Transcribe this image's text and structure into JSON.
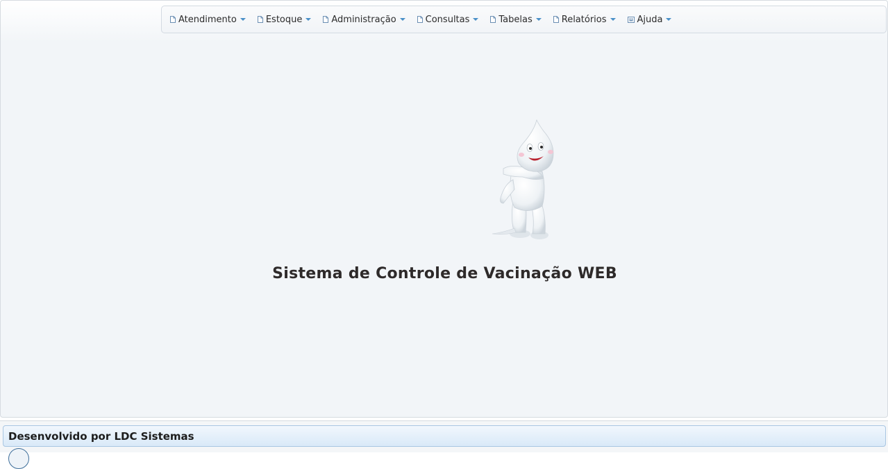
{
  "menu": {
    "items": [
      {
        "label": "Atendimento",
        "icon": "document-icon"
      },
      {
        "label": "Estoque",
        "icon": "document-icon"
      },
      {
        "label": "Administração",
        "icon": "document-icon"
      },
      {
        "label": "Consultas",
        "icon": "document-icon"
      },
      {
        "label": "Tabelas",
        "icon": "document-icon"
      },
      {
        "label": "Relatórios",
        "icon": "document-icon"
      },
      {
        "label": "Ajuda",
        "icon": "help-grid-icon"
      }
    ]
  },
  "main": {
    "title": "Sistema de Controle de Vacinação WEB",
    "mascot": "vaccine-drop-mascot"
  },
  "footer": {
    "credit": "Desenvolvido por LDC Sistemas"
  },
  "colors": {
    "accent": "#4a90c8",
    "footer_border": "#a9c6e2"
  }
}
